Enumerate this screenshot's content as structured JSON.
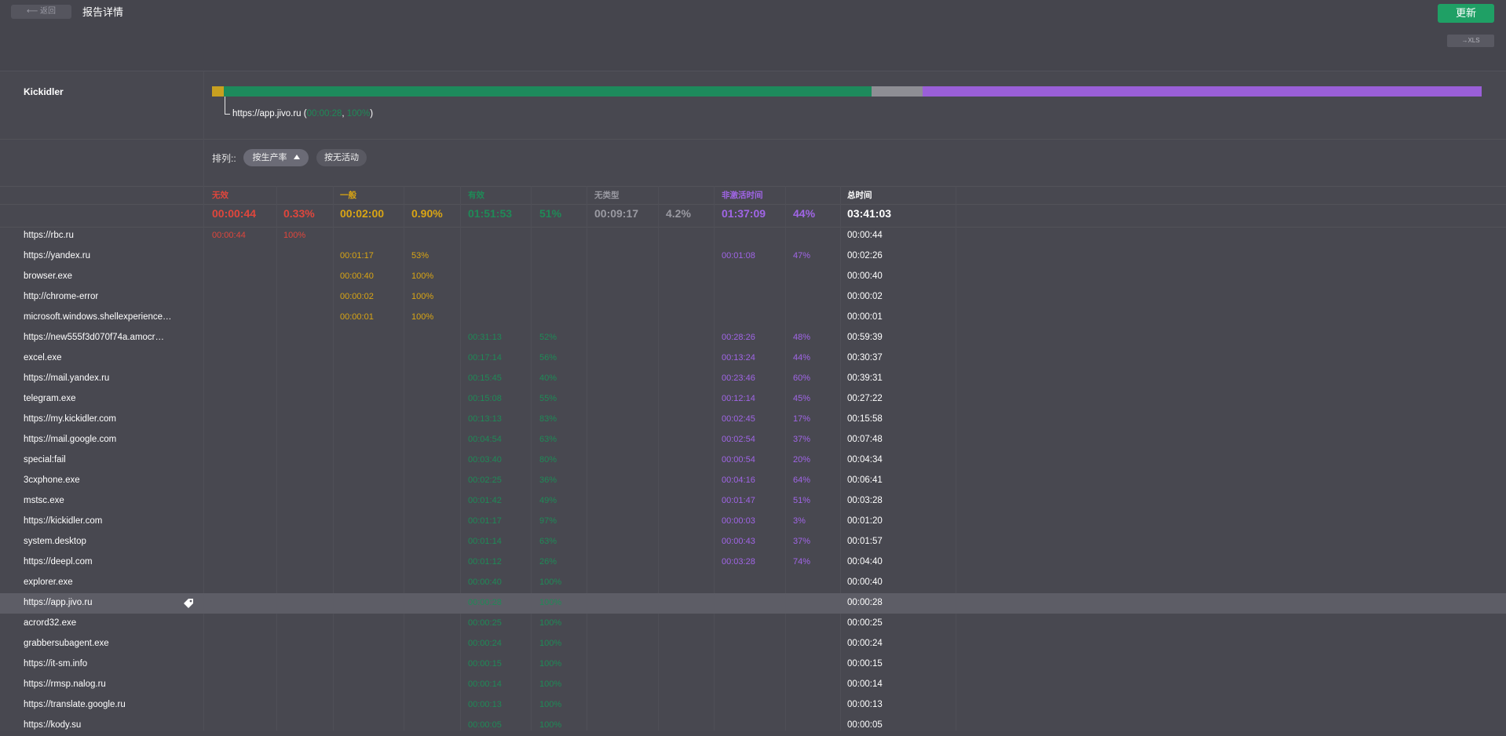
{
  "header": {
    "back_label": "⟵ 返回",
    "title": "报告详情",
    "refresh_label": "更新",
    "xls_label": "→XLS"
  },
  "user": {
    "name": "Kickidler"
  },
  "timeline": {
    "caption_site": "https://app.jivo.ru (",
    "caption_time": "00:00:28",
    "caption_sep": ", ",
    "caption_pct": "100%",
    "caption_end": ")",
    "segments": [
      {
        "category": "unproductive",
        "fraction": 0.0095,
        "color": "#c8a020"
      },
      {
        "category": "productive",
        "fraction": 0.5098,
        "color": "#1d8a5c"
      },
      {
        "category": "uncategorized",
        "fraction": 0.0403,
        "color": "#8e8e94"
      },
      {
        "category": "inactive",
        "fraction": 0.4404,
        "color": "#9a5fd8"
      }
    ]
  },
  "sort": {
    "label": "排列::",
    "by_productivity": "按生产率",
    "by_inactivity": "按无活动"
  },
  "columns": {
    "unproductive": {
      "label": "无效",
      "color": "#e0463c"
    },
    "neutral": {
      "label": "一般",
      "color": "#d9a514"
    },
    "productive": {
      "label": "有效",
      "color": "#1f8a57"
    },
    "uncategorized": {
      "label": "无类型",
      "color": "#9a9aa2"
    },
    "inactive": {
      "label": "非激活时间",
      "color": "#a065e6"
    },
    "total": {
      "label": "总时间",
      "color": "#ffffff"
    }
  },
  "totals": {
    "unproductive_time": "00:00:44",
    "unproductive_pct": "0.33%",
    "neutral_time": "00:02:00",
    "neutral_pct": "0.90%",
    "productive_time": "01:51:53",
    "productive_pct": "51%",
    "uncategorized_time": "00:09:17",
    "uncategorized_pct": "4.2%",
    "inactive_time": "01:37:09",
    "inactive_pct": "44%",
    "total": "03:41:03"
  },
  "rows": [
    {
      "name": "https://rbc.ru",
      "bad_t": "00:00:44",
      "bad_p": "100%",
      "neu_t": "",
      "neu_p": "",
      "prod_t": "",
      "prod_p": "",
      "ina_t": "",
      "ina_p": "",
      "total": "00:00:44"
    },
    {
      "name": "https://yandex.ru",
      "bad_t": "",
      "bad_p": "",
      "neu_t": "00:01:17",
      "neu_p": "53%",
      "prod_t": "",
      "prod_p": "",
      "ina_t": "00:01:08",
      "ina_p": "47%",
      "total": "00:02:26"
    },
    {
      "name": "browser.exe",
      "bad_t": "",
      "bad_p": "",
      "neu_t": "00:00:40",
      "neu_p": "100%",
      "prod_t": "",
      "prod_p": "",
      "ina_t": "",
      "ina_p": "",
      "total": "00:00:40"
    },
    {
      "name": "http://chrome-error",
      "bad_t": "",
      "bad_p": "",
      "neu_t": "00:00:02",
      "neu_p": "100%",
      "prod_t": "",
      "prod_p": "",
      "ina_t": "",
      "ina_p": "",
      "total": "00:00:02"
    },
    {
      "name": "microsoft.windows.shellexperience…",
      "bad_t": "",
      "bad_p": "",
      "neu_t": "00:00:01",
      "neu_p": "100%",
      "prod_t": "",
      "prod_p": "",
      "ina_t": "",
      "ina_p": "",
      "total": "00:00:01"
    },
    {
      "name": "https://new555f3d070f74a.amocr…",
      "bad_t": "",
      "bad_p": "",
      "neu_t": "",
      "neu_p": "",
      "prod_t": "00:31:13",
      "prod_p": "52%",
      "ina_t": "00:28:26",
      "ina_p": "48%",
      "total": "00:59:39"
    },
    {
      "name": "excel.exe",
      "bad_t": "",
      "bad_p": "",
      "neu_t": "",
      "neu_p": "",
      "prod_t": "00:17:14",
      "prod_p": "56%",
      "ina_t": "00:13:24",
      "ina_p": "44%",
      "total": "00:30:37"
    },
    {
      "name": "https://mail.yandex.ru",
      "bad_t": "",
      "bad_p": "",
      "neu_t": "",
      "neu_p": "",
      "prod_t": "00:15:45",
      "prod_p": "40%",
      "ina_t": "00:23:46",
      "ina_p": "60%",
      "total": "00:39:31"
    },
    {
      "name": "telegram.exe",
      "bad_t": "",
      "bad_p": "",
      "neu_t": "",
      "neu_p": "",
      "prod_t": "00:15:08",
      "prod_p": "55%",
      "ina_t": "00:12:14",
      "ina_p": "45%",
      "total": "00:27:22"
    },
    {
      "name": "https://my.kickidler.com",
      "bad_t": "",
      "bad_p": "",
      "neu_t": "",
      "neu_p": "",
      "prod_t": "00:13:13",
      "prod_p": "83%",
      "ina_t": "00:02:45",
      "ina_p": "17%",
      "total": "00:15:58"
    },
    {
      "name": "https://mail.google.com",
      "bad_t": "",
      "bad_p": "",
      "neu_t": "",
      "neu_p": "",
      "prod_t": "00:04:54",
      "prod_p": "63%",
      "ina_t": "00:02:54",
      "ina_p": "37%",
      "total": "00:07:48"
    },
    {
      "name": "special:fail",
      "bad_t": "",
      "bad_p": "",
      "neu_t": "",
      "neu_p": "",
      "prod_t": "00:03:40",
      "prod_p": "80%",
      "ina_t": "00:00:54",
      "ina_p": "20%",
      "total": "00:04:34"
    },
    {
      "name": "3cxphone.exe",
      "bad_t": "",
      "bad_p": "",
      "neu_t": "",
      "neu_p": "",
      "prod_t": "00:02:25",
      "prod_p": "36%",
      "ina_t": "00:04:16",
      "ina_p": "64%",
      "total": "00:06:41"
    },
    {
      "name": "mstsc.exe",
      "bad_t": "",
      "bad_p": "",
      "neu_t": "",
      "neu_p": "",
      "prod_t": "00:01:42",
      "prod_p": "49%",
      "ina_t": "00:01:47",
      "ina_p": "51%",
      "total": "00:03:28"
    },
    {
      "name": "https://kickidler.com",
      "bad_t": "",
      "bad_p": "",
      "neu_t": "",
      "neu_p": "",
      "prod_t": "00:01:17",
      "prod_p": "97%",
      "ina_t": "00:00:03",
      "ina_p": "3%",
      "total": "00:01:20"
    },
    {
      "name": "system.desktop",
      "bad_t": "",
      "bad_p": "",
      "neu_t": "",
      "neu_p": "",
      "prod_t": "00:01:14",
      "prod_p": "63%",
      "ina_t": "00:00:43",
      "ina_p": "37%",
      "total": "00:01:57"
    },
    {
      "name": "https://deepl.com",
      "bad_t": "",
      "bad_p": "",
      "neu_t": "",
      "neu_p": "",
      "prod_t": "00:01:12",
      "prod_p": "26%",
      "ina_t": "00:03:28",
      "ina_p": "74%",
      "total": "00:04:40"
    },
    {
      "name": "explorer.exe",
      "bad_t": "",
      "bad_p": "",
      "neu_t": "",
      "neu_p": "",
      "prod_t": "00:00:40",
      "prod_p": "100%",
      "ina_t": "",
      "ina_p": "",
      "total": "00:00:40"
    },
    {
      "name": "https://app.jivo.ru",
      "bad_t": "",
      "bad_p": "",
      "neu_t": "",
      "neu_p": "",
      "prod_t": "00:00:28",
      "prod_p": "100%",
      "ina_t": "",
      "ina_p": "",
      "total": "00:00:28",
      "highlight": true
    },
    {
      "name": "acrord32.exe",
      "bad_t": "",
      "bad_p": "",
      "neu_t": "",
      "neu_p": "",
      "prod_t": "00:00:25",
      "prod_p": "100%",
      "ina_t": "",
      "ina_p": "",
      "total": "00:00:25"
    },
    {
      "name": "grabbersubagent.exe",
      "bad_t": "",
      "bad_p": "",
      "neu_t": "",
      "neu_p": "",
      "prod_t": "00:00:24",
      "prod_p": "100%",
      "ina_t": "",
      "ina_p": "",
      "total": "00:00:24"
    },
    {
      "name": "https://it-sm.info",
      "bad_t": "",
      "bad_p": "",
      "neu_t": "",
      "neu_p": "",
      "prod_t": "00:00:15",
      "prod_p": "100%",
      "ina_t": "",
      "ina_p": "",
      "total": "00:00:15"
    },
    {
      "name": "https://rmsp.nalog.ru",
      "bad_t": "",
      "bad_p": "",
      "neu_t": "",
      "neu_p": "",
      "prod_t": "00:00:14",
      "prod_p": "100%",
      "ina_t": "",
      "ina_p": "",
      "total": "00:00:14"
    },
    {
      "name": "https://translate.google.ru",
      "bad_t": "",
      "bad_p": "",
      "neu_t": "",
      "neu_p": "",
      "prod_t": "00:00:13",
      "prod_p": "100%",
      "ina_t": "",
      "ina_p": "",
      "total": "00:00:13"
    },
    {
      "name": "https://kody.su",
      "bad_t": "",
      "bad_p": "",
      "neu_t": "",
      "neu_p": "",
      "prod_t": "00:00:05",
      "prod_p": "100%",
      "ina_t": "",
      "ina_p": "",
      "total": "00:00:05"
    }
  ]
}
